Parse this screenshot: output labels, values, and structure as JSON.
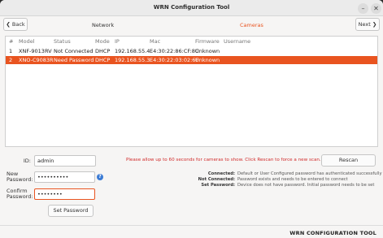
{
  "window": {
    "title": "WRN Configuration Tool"
  },
  "nav": {
    "back_label": "Back",
    "next_label": "Next",
    "tabs": [
      "Network",
      "Cameras"
    ],
    "active_tab": "Cameras",
    "accent_color": "#e95420"
  },
  "table": {
    "columns": [
      "#",
      "Model",
      "Status",
      "Mode",
      "IP",
      "Mac",
      "Firmware",
      "Username"
    ],
    "rows": [
      [
        "1",
        "XNF-9013RV",
        "Not Connected",
        "DHCP",
        "192.168.55.4",
        "E4:30:22:86:CF:8C",
        "Unknown",
        ""
      ],
      [
        "2",
        "XNO-C9083R",
        "Need Password",
        "DHCP",
        "192.168.55.3",
        "E4:30:22:03:02:6F",
        "Unknown",
        ""
      ]
    ],
    "selected_row": 2
  },
  "form": {
    "id_label": "ID:",
    "id_value": "admin",
    "new_password_label_1": "New",
    "new_password_label_2": "Password:",
    "new_password_value": "••••••••••",
    "confirm_password_label_1": "Confirm",
    "confirm_password_label_2": "Password:",
    "confirm_password_value": "••••••••",
    "set_password_label": "Set Password",
    "info_icon": "info-icon"
  },
  "hint": "Please allow up to 60 seconds for cameras to show. Click Rescan to force a new scan.",
  "rescan_label": "Rescan",
  "legend": [
    {
      "key": "Connected:",
      "value": "Default or User Configured password has authenticated successfully"
    },
    {
      "key": "Not Connected:",
      "value": "Password exists and needs to be entered to connect"
    },
    {
      "key": "Set Password:",
      "value": "Device does not have password. Initial password needs to be set"
    }
  ],
  "brand": "WRN CONFIGURATION TOOL"
}
